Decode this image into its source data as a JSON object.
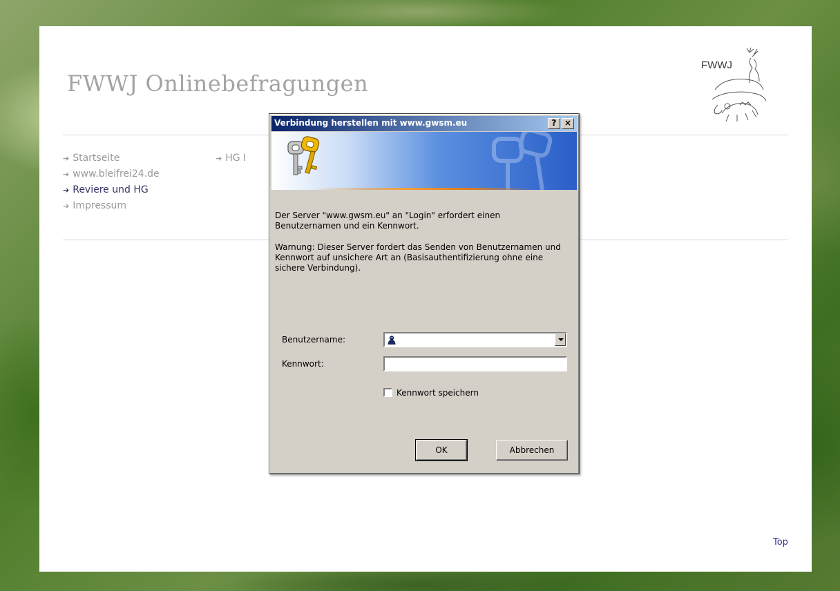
{
  "site": {
    "title": "FWWJ Onlinebefragungen",
    "logo_text": "FWWJ"
  },
  "nav": {
    "items": [
      {
        "label": "Startseite"
      },
      {
        "label": "www.bleifrei24.de"
      },
      {
        "label": "Reviere und HG",
        "active": true
      },
      {
        "label": "Impressum"
      }
    ],
    "col2_items": [
      {
        "label": "HG I"
      }
    ]
  },
  "footer": {
    "top_link": "Top"
  },
  "dialog": {
    "title": "Verbindung herstellen mit www.gwsm.eu",
    "help_button": "?",
    "close_button": "×",
    "message1": "Der Server \"www.gwsm.eu\" an \"Login\" erfordert einen Benutzernamen und ein Kennwort.",
    "message2": "Warnung: Dieser Server fordert das Senden von Benutzernamen und Kennwort auf unsichere Art an (Basisauthentifizierung ohne eine sichere Verbindung).",
    "username_label": "Benutzername:",
    "username_value": "",
    "password_label": "Kennwort:",
    "password_value": "",
    "remember_label": "Kennwort speichern",
    "remember_checked": false,
    "ok_label": "OK",
    "cancel_label": "Abbrechen"
  },
  "colors": {
    "titlebar_start": "#0a246a",
    "titlebar_end": "#a6caf0",
    "dialog_face": "#d4d0c8",
    "nav_active": "#333366",
    "site_title": "#a3a3a3"
  },
  "icons": [
    "keys-icon",
    "user-icon",
    "deer-logo"
  ]
}
